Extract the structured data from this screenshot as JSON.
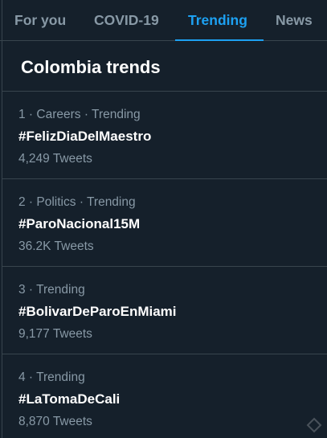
{
  "tabs": [
    {
      "label": "For you"
    },
    {
      "label": "COVID-19"
    },
    {
      "label": "Trending"
    },
    {
      "label": "News"
    }
  ],
  "active_tab": "Trending",
  "section": {
    "title": "Colombia trends"
  },
  "trends": [
    {
      "rank": "1",
      "category": "Careers",
      "status": "Trending",
      "name": "#FelizDiaDelMaestro",
      "count": "4,249 Tweets"
    },
    {
      "rank": "2",
      "category": "Politics",
      "status": "Trending",
      "name": "#ParoNacional15M",
      "count": "36.2K Tweets"
    },
    {
      "rank": "3",
      "category": "",
      "status": "Trending",
      "name": "#BolivarDeParoEnMiami",
      "count": "9,177 Tweets"
    },
    {
      "rank": "4",
      "category": "",
      "status": "Trending",
      "name": "#LaTomaDeCali",
      "count": "8,870 Tweets"
    }
  ],
  "colors": {
    "background": "#15202b",
    "accent": "#1da1f2",
    "muted": "#8899a6",
    "border": "#38444d"
  }
}
